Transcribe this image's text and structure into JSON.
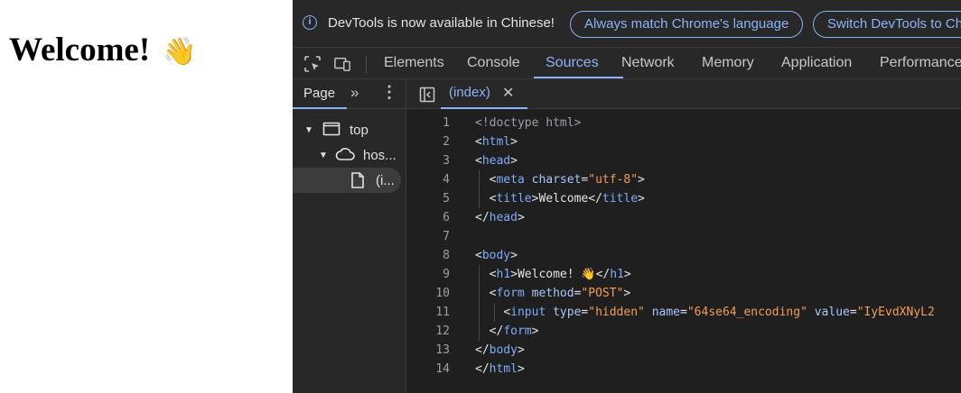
{
  "page": {
    "heading": "Welcome!",
    "emoji": "👋"
  },
  "devtools": {
    "infobar": {
      "text": "DevTools is now available in Chinese!",
      "button1": "Always match Chrome's language",
      "button2": "Switch DevTools to Chinese"
    },
    "tabs": [
      "Elements",
      "Console",
      "Sources",
      "Network",
      "Memory",
      "Application",
      "Performance"
    ],
    "active_tab": "Sources",
    "navigator": {
      "tab": "Page",
      "tree": [
        {
          "label": "top",
          "icon": "frame-icon",
          "expanded": true
        },
        {
          "label": "hos...",
          "icon": "cloud-icon",
          "expanded": true
        },
        {
          "label": "(i...",
          "icon": "file-icon",
          "selected": true
        }
      ]
    },
    "editor": {
      "file_tab": "(index)",
      "line_numbers": [
        "1",
        "2",
        "3",
        "4",
        "5",
        "6",
        "7",
        "8",
        "9",
        "10",
        "11",
        "12",
        "13",
        "14"
      ],
      "lines": [
        "<!doctype html>",
        "<html>",
        "<head>",
        "  <meta charset=\"utf-8\">",
        "  <title>Welcome</title>",
        "</head>",
        "",
        "<body>",
        "  <h1>Welcome! 👋</h1>",
        "  <form method=\"POST\">",
        "    <input type=\"hidden\" name=\"64se64_encoding\" value=\"IyEvdXNyL2",
        "  </form>",
        "</body>",
        "</html>"
      ]
    },
    "colors": {
      "accent": "#8ab4f8",
      "background": "#282828",
      "editor_bg": "#1f1f1f",
      "tag": "#7cacf8",
      "attr_value": "#f29c58"
    }
  }
}
